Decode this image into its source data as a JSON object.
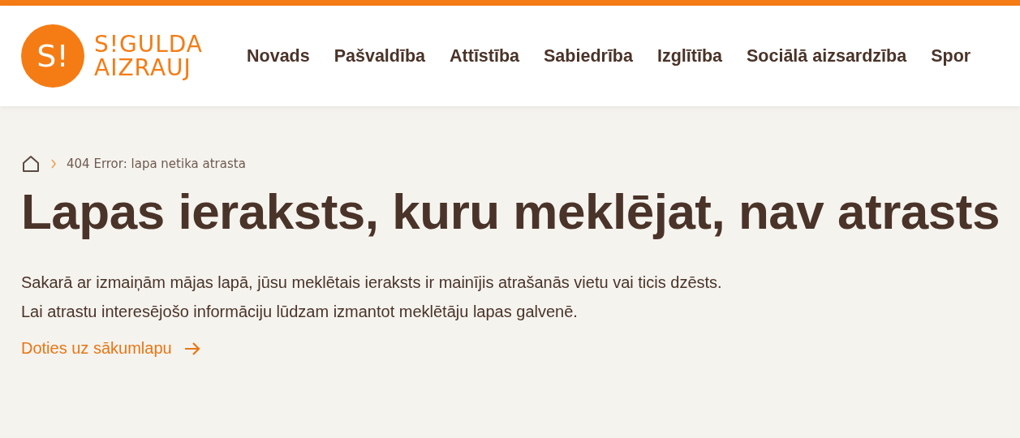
{
  "logo": {
    "mark": "S!",
    "line_1": "S!GULDA",
    "line_2": "AIZRAUJ"
  },
  "nav": [
    "Novads",
    "Pašvaldība",
    "Attīstība",
    "Sabiedrība",
    "Izglītība",
    "Sociālā aizsardzība",
    "Spor"
  ],
  "breadcrumb": {
    "current": "404 Error: lapa netika atrasta"
  },
  "heading": "Lapas ieraksts, kuru meklējat, nav atrasts",
  "body": "Sakarā ar izmaiņām mājas lapā, jūsu meklētais ieraksts ir mainījis atrašanās vietu vai ticis dzēsts. Lai atrastu interesējošo informāciju lūdzam izmantot meklētāju lapas galvenē.",
  "home_link": "Doties uz sākumlapu"
}
